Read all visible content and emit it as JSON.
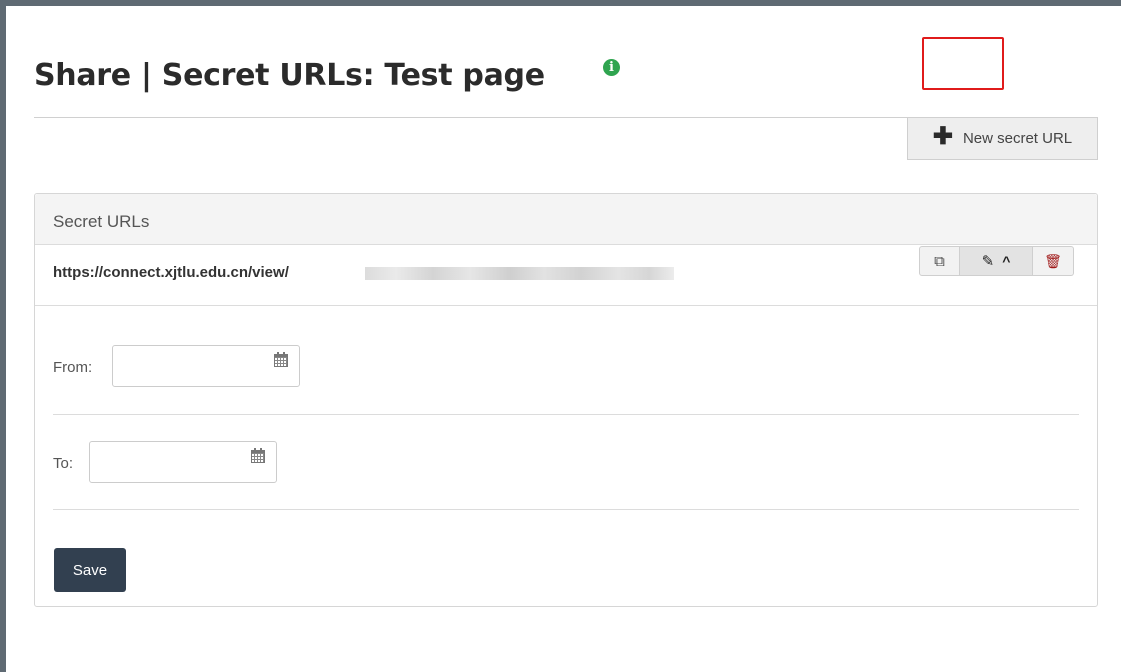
{
  "page": {
    "title": "Share | Secret URLs: Test page",
    "info_icon": "info-circle-icon"
  },
  "toolbar": {
    "new_secret_url_label": "New secret URL",
    "new_secret_url_icon": "plus-icon"
  },
  "panel": {
    "heading": "Secret URLs",
    "urls": [
      {
        "url": "https://connect.xjtlu.edu.cn/view/",
        "url_suffix_redacted": true,
        "actions": [
          {
            "name": "copy",
            "icon": "copy-icon"
          },
          {
            "name": "edit",
            "icon": "pencil-icon",
            "expand_icon": "chevron-up-icon",
            "highlighted": true
          },
          {
            "name": "delete",
            "icon": "trash-icon"
          }
        ]
      }
    ],
    "form": {
      "from_label": "From:",
      "from_value": "",
      "to_label": "To:",
      "to_value": "",
      "save_label": "Save"
    }
  },
  "colors": {
    "frame": "#5f6a73",
    "info_icon": "#2fa44f",
    "save_button": "#324050",
    "highlight": "#e01b1b",
    "delete_icon": "#a01818"
  }
}
